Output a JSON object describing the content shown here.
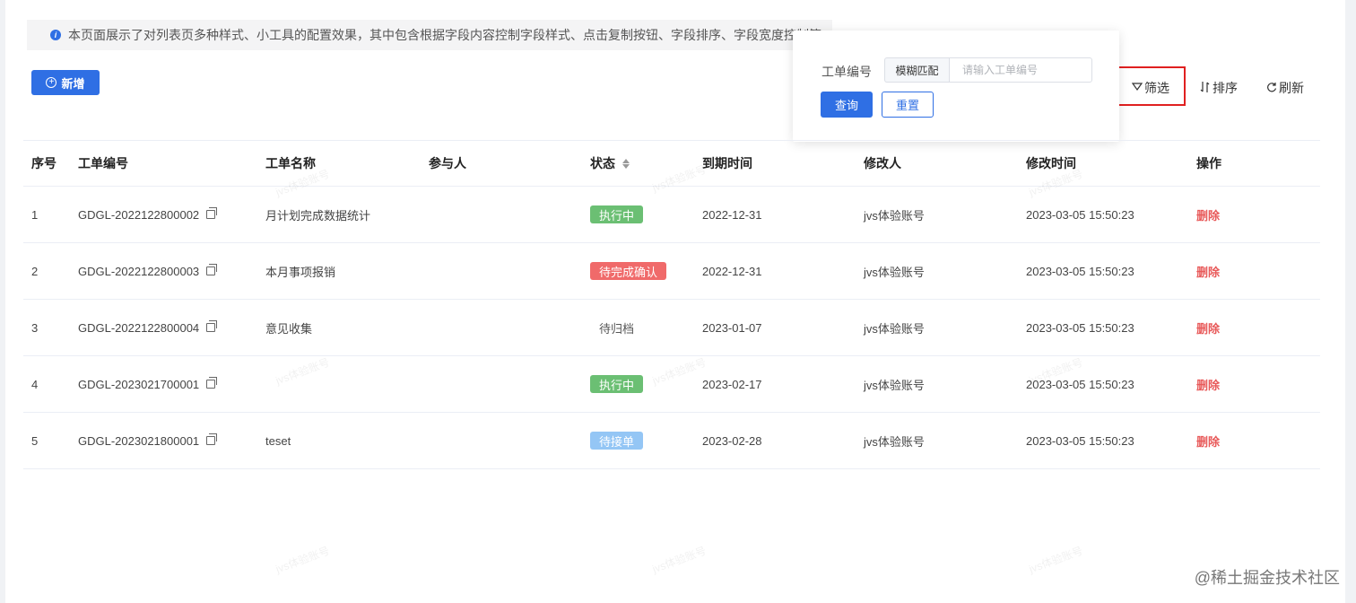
{
  "notice": "本页面展示了对列表页多种样式、小工具的配置效果，其中包含根据字段内容控制字段样式、点击复制按钮、字段排序、字段宽度控制等",
  "toolbar": {
    "add_label": "新增",
    "filter_label": "筛选",
    "sort_label": "排序",
    "refresh_label": "刷新"
  },
  "filter": {
    "field_label": "工单编号",
    "mode": "模糊匹配",
    "placeholder": "请输入工单编号",
    "query_label": "查询",
    "reset_label": "重置"
  },
  "columns": [
    "序号",
    "工单编号",
    "工单名称",
    "参与人",
    "状态",
    "到期时间",
    "修改人",
    "修改时间",
    "操作"
  ],
  "rows": [
    {
      "idx": "1",
      "code": "GDGL-2022122800002",
      "name": "月计划完成数据统计",
      "participants": "",
      "status": "执行中",
      "status_color": "#6bbf73",
      "due": "2022-12-31",
      "modifier": "jvs体验账号",
      "modified": "2023-03-05 15:50:23",
      "action": "删除"
    },
    {
      "idx": "2",
      "code": "GDGL-2022122800003",
      "name": "本月事项报销",
      "participants": "",
      "status": "待完成确认",
      "status_color": "#f06a6a",
      "due": "2022-12-31",
      "modifier": "jvs体验账号",
      "modified": "2023-03-05 15:50:23",
      "action": "删除"
    },
    {
      "idx": "3",
      "code": "GDGL-2022122800004",
      "name": "意见收集",
      "participants": "",
      "status": "待归档",
      "status_color": "",
      "due": "2023-01-07",
      "modifier": "jvs体验账号",
      "modified": "2023-03-05 15:50:23",
      "action": "删除"
    },
    {
      "idx": "4",
      "code": "GDGL-2023021700001",
      "name": "",
      "participants": "",
      "status": "执行中",
      "status_color": "#6bbf73",
      "due": "2023-02-17",
      "modifier": "jvs体验账号",
      "modified": "2023-03-05 15:50:23",
      "action": "删除"
    },
    {
      "idx": "5",
      "code": "GDGL-2023021800001",
      "name": "teset",
      "participants": "",
      "status": "待接单",
      "status_color": "#94c6f5",
      "due": "2023-02-28",
      "modifier": "jvs体验账号",
      "modified": "2023-03-05 15:50:23",
      "action": "删除"
    }
  ],
  "watermark": "jvs体验账号",
  "footer_watermark": "@稀土掘金技术社区"
}
